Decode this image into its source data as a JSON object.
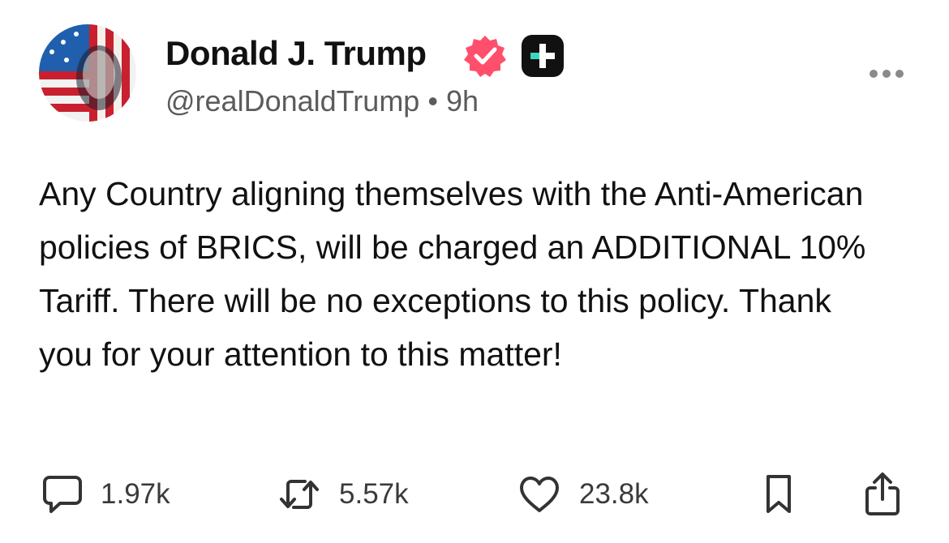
{
  "author": {
    "name": "Donald J. Trump",
    "handle": "@realDonaldTrump",
    "separator": "•",
    "time": "9h"
  },
  "post": {
    "text": "Any Country aligning themselves with the Anti-American policies of BRICS, will be charged an ADDITIONAL 10% Tariff. There will be no exceptions to this policy. Thank you for your attention to this matter!"
  },
  "actions": {
    "replies": "1.97k",
    "reposts": "5.57k",
    "likes": "23.8k"
  },
  "colors": {
    "verified": "#ff4f6d",
    "badge_dark": "#111111",
    "badge_accent": "#3ad6c0",
    "text": "#111111",
    "muted": "#5b5b5b"
  },
  "icons": {
    "verified": "verified-badge-icon",
    "plus": "plus-badge-icon",
    "more": "more-options-icon",
    "reply": "speech-bubble-icon",
    "repost": "repost-arrows-icon",
    "like": "heart-icon",
    "bookmark": "bookmark-icon",
    "share": "share-icon"
  }
}
